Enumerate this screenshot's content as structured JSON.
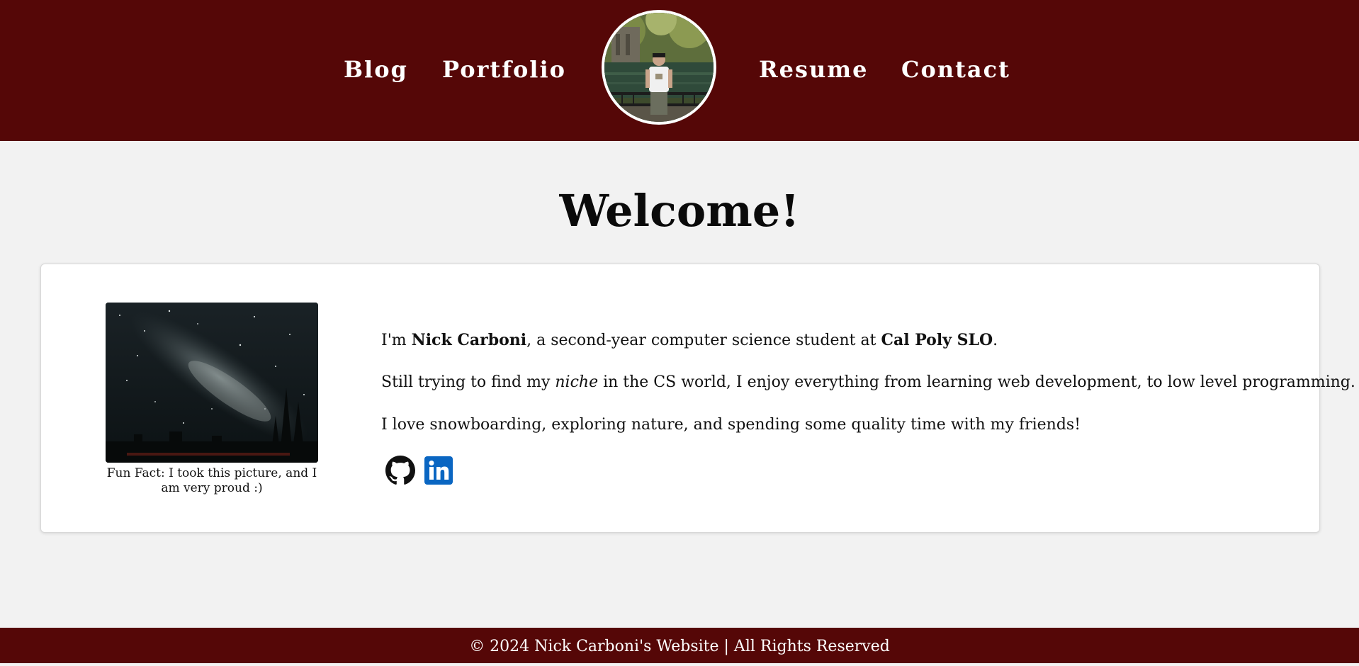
{
  "nav": {
    "blog": "Blog",
    "portfolio": "Portfolio",
    "resume": "Resume",
    "contact": "Contact"
  },
  "heading": "Welcome!",
  "photo": {
    "caption": "Fun Fact: I took this picture, and I am very proud :)"
  },
  "bio": {
    "line1": {
      "pre": "I'm ",
      "name": "Nick Carboni",
      "mid": ", a second-year computer science student at ",
      "school": "Cal Poly SLO",
      "post": "."
    },
    "line2": {
      "pre": "Still trying to find my ",
      "emph": "niche",
      "post": " in the CS world, I enjoy everything from learning web development, to low level programming."
    },
    "line3": "I love snowboarding, exploring nature, and spending some quality time with my friends!"
  },
  "socials": [
    {
      "icon": "github-icon",
      "color": "#111111"
    },
    {
      "icon": "linkedin-icon",
      "color": "#0a66c2"
    }
  ],
  "footer": "© 2024 Nick Carboni's Website | All Rights Reserved",
  "colors": {
    "header_bg": "#550707",
    "page_bg": "#f2f2f2",
    "card_bg": "#ffffff"
  }
}
